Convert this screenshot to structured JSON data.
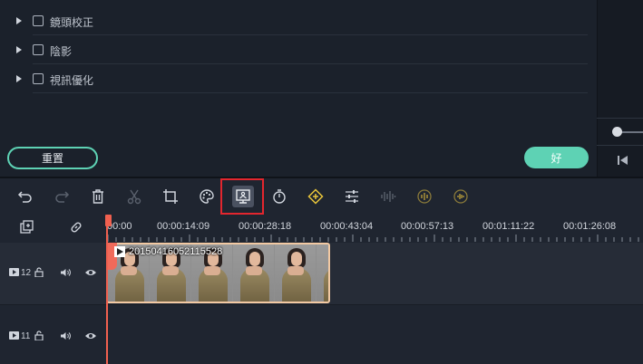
{
  "settings": {
    "rows": [
      {
        "label": "鏡頭校正"
      },
      {
        "label": "陰影"
      },
      {
        "label": "視訊優化"
      }
    ],
    "reset_label": "重置",
    "ok_label": "好"
  },
  "toolbar": {
    "tools": [
      "undo-icon",
      "redo-icon",
      "delete-icon",
      "cut-icon",
      "crop-icon",
      "color-icon",
      "stabilization-icon",
      "speed-icon",
      "keyframe-icon",
      "adjust-icon",
      "audio-wave-icon",
      "audio-ducking-icon",
      "audio-stretch-icon"
    ]
  },
  "timeline": {
    "ruler_labels": [
      "00:00",
      "00:00:14:09",
      "00:00:28:18",
      "00:00:43:04",
      "00:00:57:13",
      "00:01:11:22",
      "00:01:26:08"
    ],
    "tracks": [
      {
        "number": "12"
      },
      {
        "number": "11"
      }
    ],
    "clip": {
      "title": "20150416052115528"
    }
  },
  "colors": {
    "accent": "#5ed2b4",
    "playhead": "#f0604f",
    "highlight": "#e3262e",
    "keyframe": "#e8c53a"
  }
}
